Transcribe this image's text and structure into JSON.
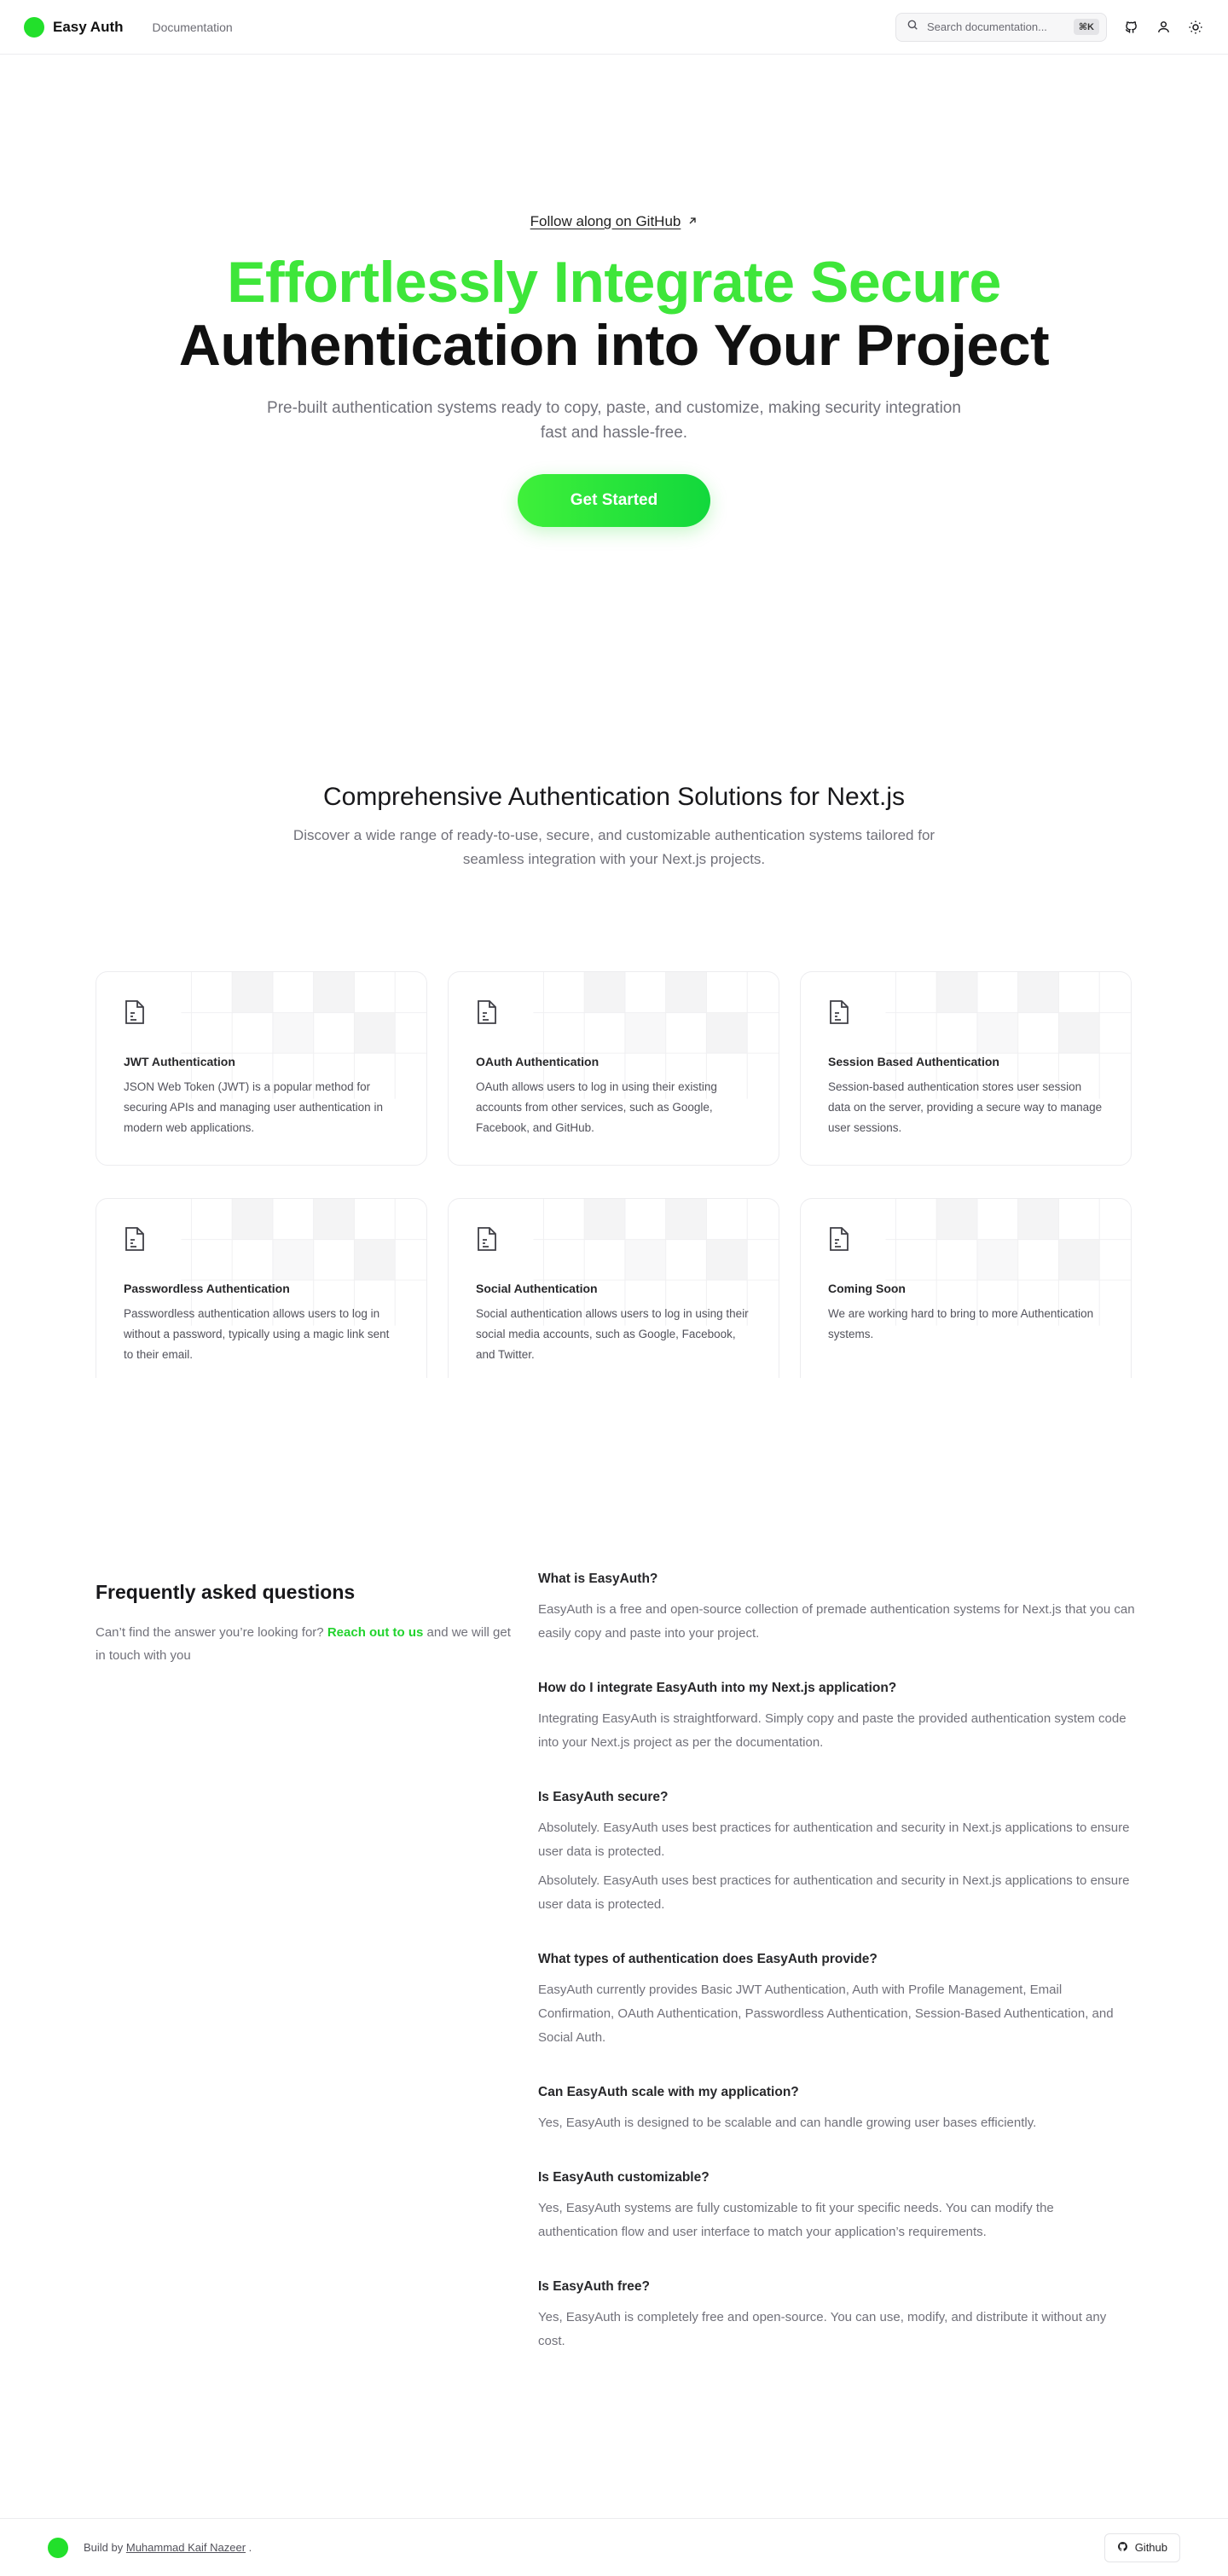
{
  "header": {
    "brand": "Easy Auth",
    "nav_documentation": "Documentation",
    "search_placeholder": "Search documentation...",
    "search_shortcut": "⌘K",
    "icons": [
      "github-icon",
      "user-icon",
      "sun-icon"
    ]
  },
  "hero": {
    "github_link": "Follow along on GitHub",
    "title_line1": "Effortlessly Integrate Secure",
    "title_line2": "Authentication into Your Project",
    "subtitle": "Pre-built authentication systems ready to copy, paste, and customize, making security integration fast and hassle-free.",
    "cta": "Get Started"
  },
  "features": {
    "title": "Comprehensive Authentication Solutions for Next.js",
    "subtitle": "Discover a wide range of ready-to-use, secure, and customizable authentication systems tailored for seamless integration with your Next.js projects.",
    "cards": [
      {
        "title": "JWT Authentication",
        "desc": "JSON Web Token (JWT) is a popular method for securing APIs and managing user authentication in modern web applications."
      },
      {
        "title": "OAuth Authentication",
        "desc": "OAuth allows users to log in using their existing accounts from other services, such as Google, Facebook, and GitHub."
      },
      {
        "title": "Session Based Authentication",
        "desc": "Session-based authentication stores user session data on the server, providing a secure way to manage user sessions."
      },
      {
        "title": "Passwordless Authentication",
        "desc": "Passwordless authentication allows users to log in without a password, typically using a magic link sent to their email."
      },
      {
        "title": "Social Authentication",
        "desc": "Social authentication allows users to log in using their social media accounts, such as Google, Facebook, and Twitter."
      },
      {
        "title": "Coming Soon",
        "desc": "We are working hard to bring to more Authentication systems."
      }
    ]
  },
  "faq": {
    "title": "Frequently asked questions",
    "lead_before": "Can’t find the answer you’re looking for? ",
    "lead_link": "Reach out to us",
    "lead_after": " and we will get in touch with you",
    "items": [
      {
        "q": "What is EasyAuth?",
        "a": [
          "EasyAuth is a free and open-source collection of premade authentication systems for Next.js that you can easily copy and paste into your project."
        ]
      },
      {
        "q": "How do I integrate EasyAuth into my Next.js application?",
        "a": [
          "Integrating EasyAuth is straightforward. Simply copy and paste the provided authentication system code into your Next.js project as per the documentation."
        ]
      },
      {
        "q": "Is EasyAuth secure?",
        "a": [
          "Absolutely. EasyAuth uses best practices for authentication and security in Next.js applications to ensure user data is protected.",
          "Absolutely. EasyAuth uses best practices for authentication and security in Next.js applications to ensure user data is protected."
        ]
      },
      {
        "q": "What types of authentication does EasyAuth provide?",
        "a": [
          "EasyAuth currently provides Basic JWT Authentication, Auth with Profile Management, Email Confirmation, OAuth Authentication, Passwordless Authentication, Session-Based Authentication, and Social Auth."
        ]
      },
      {
        "q": "Can EasyAuth scale with my application?",
        "a": [
          "Yes, EasyAuth is designed to be scalable and can handle growing user bases efficiently."
        ]
      },
      {
        "q": "Is EasyAuth customizable?",
        "a": [
          "Yes, EasyAuth systems are fully customizable to fit your specific needs. You can modify the authentication flow and user interface to match your application’s requirements."
        ]
      },
      {
        "q": "Is EasyAuth free?",
        "a": [
          "Yes, EasyAuth is completely free and open-source. You can use, modify, and distribute it without any cost."
        ]
      }
    ]
  },
  "footer": {
    "build_by": "Build by",
    "author": "Muhammad Kaif Nazeer",
    "after": " .",
    "github_button": "Github"
  },
  "colors": {
    "accent": "#22e02b",
    "hero_green": "#3ee63a",
    "text_muted": "#71717a"
  }
}
